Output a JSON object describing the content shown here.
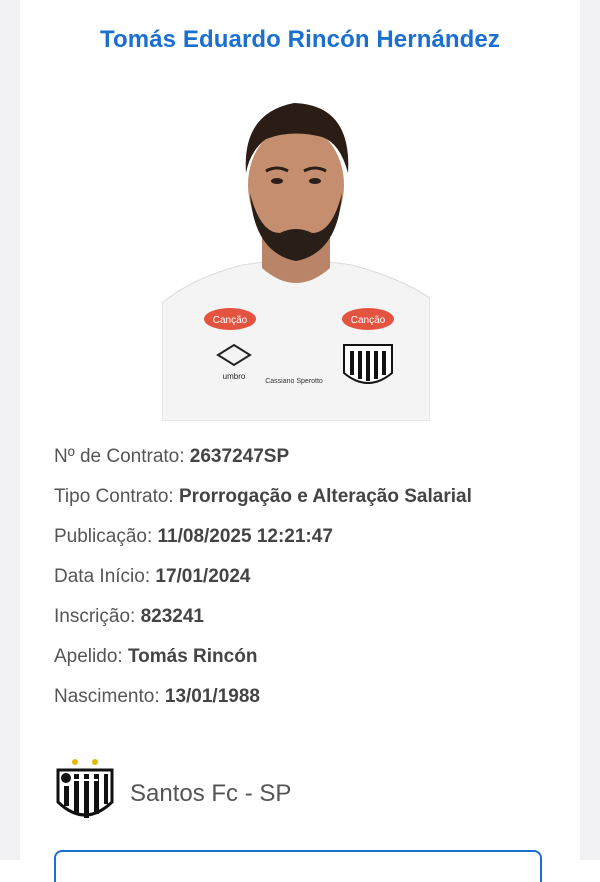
{
  "player": {
    "name": "Tomás Eduardo Rincón Hernández",
    "jersey_brands": {
      "sponsor": "Canção",
      "kit": "umbro",
      "sleeve": "Cassiano Sperotto"
    }
  },
  "fields": [
    {
      "label": "Nº de Contrato:",
      "value": "2637247SP"
    },
    {
      "label": "Tipo Contrato:",
      "value": "Prorrogação e Alteração Salarial"
    },
    {
      "label": "Publicação:",
      "value": "11/08/2025 12:21:47"
    },
    {
      "label": "Data Início:",
      "value": "17/01/2024"
    },
    {
      "label": "Inscrição:",
      "value": "823241"
    },
    {
      "label": "Apelido:",
      "value": "Tomás Rincón"
    },
    {
      "label": "Nascimento:",
      "value": "13/01/1988"
    }
  ],
  "club": {
    "name": "Santos Fc - SP",
    "crest_icon": "santos-crest-icon"
  },
  "colors": {
    "title": "#1a6fd1",
    "label": "#555555",
    "value": "#444444"
  }
}
